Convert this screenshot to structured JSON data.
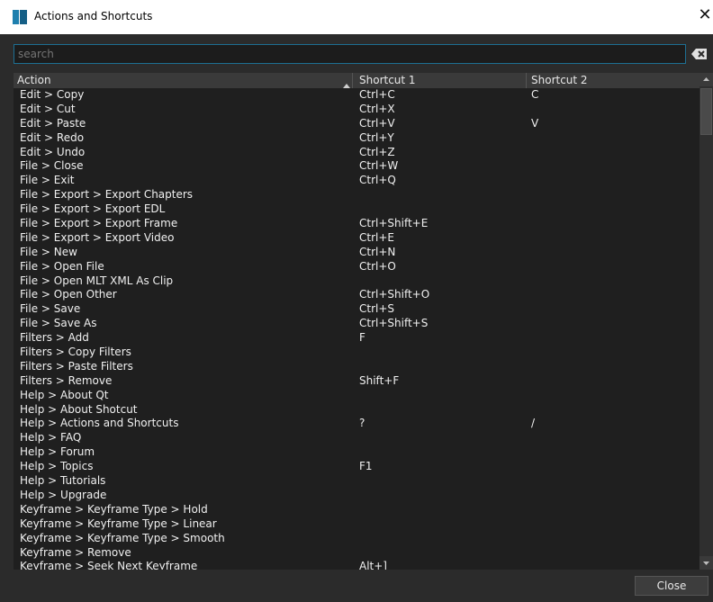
{
  "window": {
    "title": "Actions and Shortcuts",
    "close_glyph": "✕"
  },
  "search": {
    "placeholder": "search",
    "clear_icon": "backspace-clear-icon"
  },
  "table": {
    "headers": {
      "action": "Action",
      "shortcut1": "Shortcut 1",
      "shortcut2": "Shortcut 2"
    },
    "sort": {
      "column": "Action",
      "direction": "ascending"
    },
    "rows": [
      {
        "action": "Edit > Copy",
        "s1": "Ctrl+C",
        "s2": "C"
      },
      {
        "action": "Edit > Cut",
        "s1": "Ctrl+X",
        "s2": ""
      },
      {
        "action": "Edit > Paste",
        "s1": "Ctrl+V",
        "s2": "V"
      },
      {
        "action": "Edit > Redo",
        "s1": "Ctrl+Y",
        "s2": ""
      },
      {
        "action": "Edit > Undo",
        "s1": "Ctrl+Z",
        "s2": ""
      },
      {
        "action": "File > Close",
        "s1": "Ctrl+W",
        "s2": ""
      },
      {
        "action": "File > Exit",
        "s1": "Ctrl+Q",
        "s2": ""
      },
      {
        "action": "File > Export > Export Chapters",
        "s1": "",
        "s2": ""
      },
      {
        "action": "File > Export > Export EDL",
        "s1": "",
        "s2": ""
      },
      {
        "action": "File > Export > Export Frame",
        "s1": "Ctrl+Shift+E",
        "s2": ""
      },
      {
        "action": "File > Export > Export Video",
        "s1": "Ctrl+E",
        "s2": ""
      },
      {
        "action": "File > New",
        "s1": "Ctrl+N",
        "s2": ""
      },
      {
        "action": "File > Open File",
        "s1": "Ctrl+O",
        "s2": ""
      },
      {
        "action": "File > Open MLT XML As Clip",
        "s1": "",
        "s2": ""
      },
      {
        "action": "File > Open Other",
        "s1": "Ctrl+Shift+O",
        "s2": ""
      },
      {
        "action": "File > Save",
        "s1": "Ctrl+S",
        "s2": ""
      },
      {
        "action": "File > Save As",
        "s1": "Ctrl+Shift+S",
        "s2": ""
      },
      {
        "action": "Filters > Add",
        "s1": "F",
        "s2": ""
      },
      {
        "action": "Filters > Copy Filters",
        "s1": "",
        "s2": ""
      },
      {
        "action": "Filters > Paste Filters",
        "s1": "",
        "s2": ""
      },
      {
        "action": "Filters > Remove",
        "s1": "Shift+F",
        "s2": ""
      },
      {
        "action": "Help > About Qt",
        "s1": "",
        "s2": ""
      },
      {
        "action": "Help > About Shotcut",
        "s1": "",
        "s2": ""
      },
      {
        "action": "Help > Actions and Shortcuts",
        "s1": "?",
        "s2": "/"
      },
      {
        "action": "Help > FAQ",
        "s1": "",
        "s2": ""
      },
      {
        "action": "Help > Forum",
        "s1": "",
        "s2": ""
      },
      {
        "action": "Help > Topics",
        "s1": "F1",
        "s2": ""
      },
      {
        "action": "Help > Tutorials",
        "s1": "",
        "s2": ""
      },
      {
        "action": "Help > Upgrade",
        "s1": "",
        "s2": ""
      },
      {
        "action": "Keyframe > Keyframe Type > Hold",
        "s1": "",
        "s2": ""
      },
      {
        "action": "Keyframe > Keyframe Type > Linear",
        "s1": "",
        "s2": ""
      },
      {
        "action": "Keyframe > Keyframe Type > Smooth",
        "s1": "",
        "s2": ""
      },
      {
        "action": "Keyframe > Remove",
        "s1": "",
        "s2": ""
      },
      {
        "action": "Keyframe > Seek Next Keyframe",
        "s1": "Alt+]",
        "s2": ""
      }
    ]
  },
  "buttons": {
    "close_label": "Close"
  },
  "colors": {
    "background": "#2b2b2b",
    "table_bg": "#1f1f1f",
    "header_bg": "#3a3a3a",
    "accent": "#1d6f93",
    "text": "#f0f0f0"
  }
}
